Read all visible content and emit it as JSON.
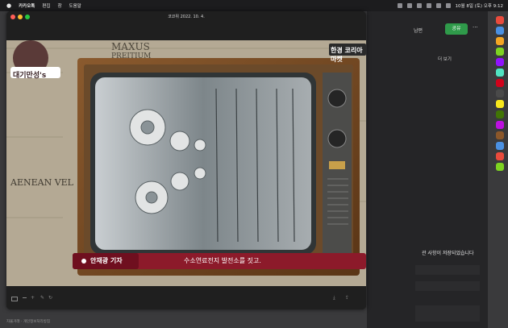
{
  "menubar": {
    "apple": "",
    "app_name": "카카오톡",
    "items": [
      "편집",
      "창",
      "도움말"
    ],
    "clock": "10월 8일 (토) 오후 9:12"
  },
  "window": {
    "title": "코코위 2022. 10. 4."
  },
  "video": {
    "logo_left": "대기만성's",
    "logo_right": "한경 코리아마켓",
    "caption_place": "안재광 기자",
    "caption_text": "수소연료전지 발전소를 짓고."
  },
  "background_app": {
    "partial_label": "남편",
    "share_label": "공유",
    "more_label": "···",
    "see_more_label": "더 보기",
    "saved_msg": "관 사항이 저장되었습니다"
  },
  "status_text": "자율거래 · 개인정보처리방침"
}
